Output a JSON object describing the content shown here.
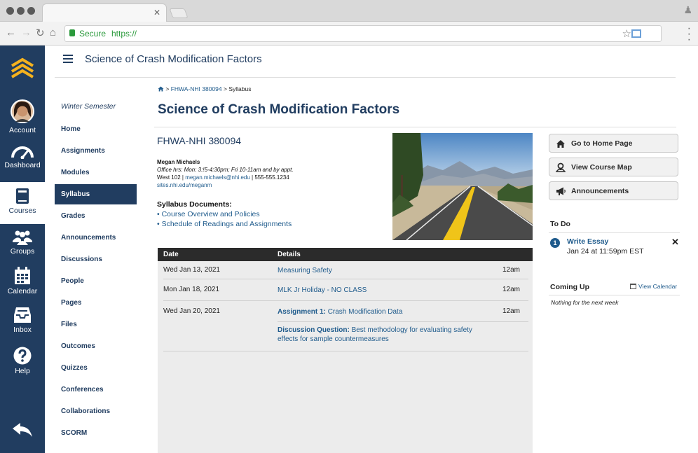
{
  "browser": {
    "url": "https://",
    "secure_label": "Secure"
  },
  "global_nav": {
    "items": [
      {
        "label": "Account",
        "icon": "avatar"
      },
      {
        "label": "Dashboard",
        "icon": "speedometer-icon"
      },
      {
        "label": "Courses",
        "icon": "book-icon"
      },
      {
        "label": "Groups",
        "icon": "group-icon"
      },
      {
        "label": "Calendar",
        "icon": "calendar-icon"
      },
      {
        "label": "Inbox",
        "icon": "inbox-icon"
      },
      {
        "label": "Help",
        "icon": "help-icon"
      }
    ],
    "active": "Courses"
  },
  "header": {
    "title": "Science of Crash Modification Factors"
  },
  "course_nav": {
    "term": "Winter Semester",
    "items": [
      "Home",
      "Assignments",
      "Modules",
      "Syllabus",
      "Grades",
      "Announcements",
      "Discussions",
      "People",
      "Pages",
      "Files",
      "Outcomes",
      "Quizzes",
      "Conferences",
      "Collaborations",
      "SCORM"
    ],
    "active": "Syllabus"
  },
  "breadcrumb": {
    "course": "FHWA-NHI 380094",
    "separator": ">",
    "current": "Syllabus"
  },
  "page": {
    "title": "Science of Crash Modification Factors",
    "course_code": "FHWA-NHI 380094",
    "instructor": {
      "name": "Megan Michaels",
      "office_hours": "Office hrs: Mon: 3:!5-4:30pm; Fri 10-11am and by appt.",
      "room": "West 102",
      "email": "megan.michaels@nhi.edu",
      "phone": "555-555.1234",
      "website": "sites.nhi.edu/meganm"
    },
    "syllabus_docs_heading": "Syllabus Documents:",
    "syllabus_docs": [
      "Course Overview and Policies",
      "Schedule of Readings and Assignments"
    ]
  },
  "schedule": {
    "headers": {
      "date": "Date",
      "details": "Details"
    },
    "rows": [
      {
        "date": "Wed Jan 13, 2021",
        "detail": "Measuring Safety",
        "time": "12am"
      },
      {
        "date": "Mon Jan 18, 2021",
        "detail": "MLK Jr Holiday - NO CLASS",
        "time": "12am"
      },
      {
        "date": "Wed Jan 20, 2021",
        "detail_prefix": "Assignment 1:",
        "detail": "Crash Modification Data",
        "time": "12am"
      },
      {
        "date": "",
        "detail_prefix": "Discussion Question:",
        "detail": "Best methodology for evaluating safety effects for sample countermeasures",
        "time": ""
      }
    ]
  },
  "sidebar": {
    "buttons": [
      "Go to Home Page",
      "View Course Map",
      "Announcements"
    ],
    "todo_heading": "To Do",
    "todo": {
      "count": "1",
      "title": "Write Essay",
      "due": "Jan 24 at 11:59pm EST"
    },
    "coming_up_heading": "Coming Up",
    "view_calendar": "View Calendar",
    "coming_up_empty": "Nothing for the next week"
  },
  "colors": {
    "nav_bg": "#213d60",
    "link": "#1f5b8c",
    "logo_yellow": "#f5b21e"
  }
}
